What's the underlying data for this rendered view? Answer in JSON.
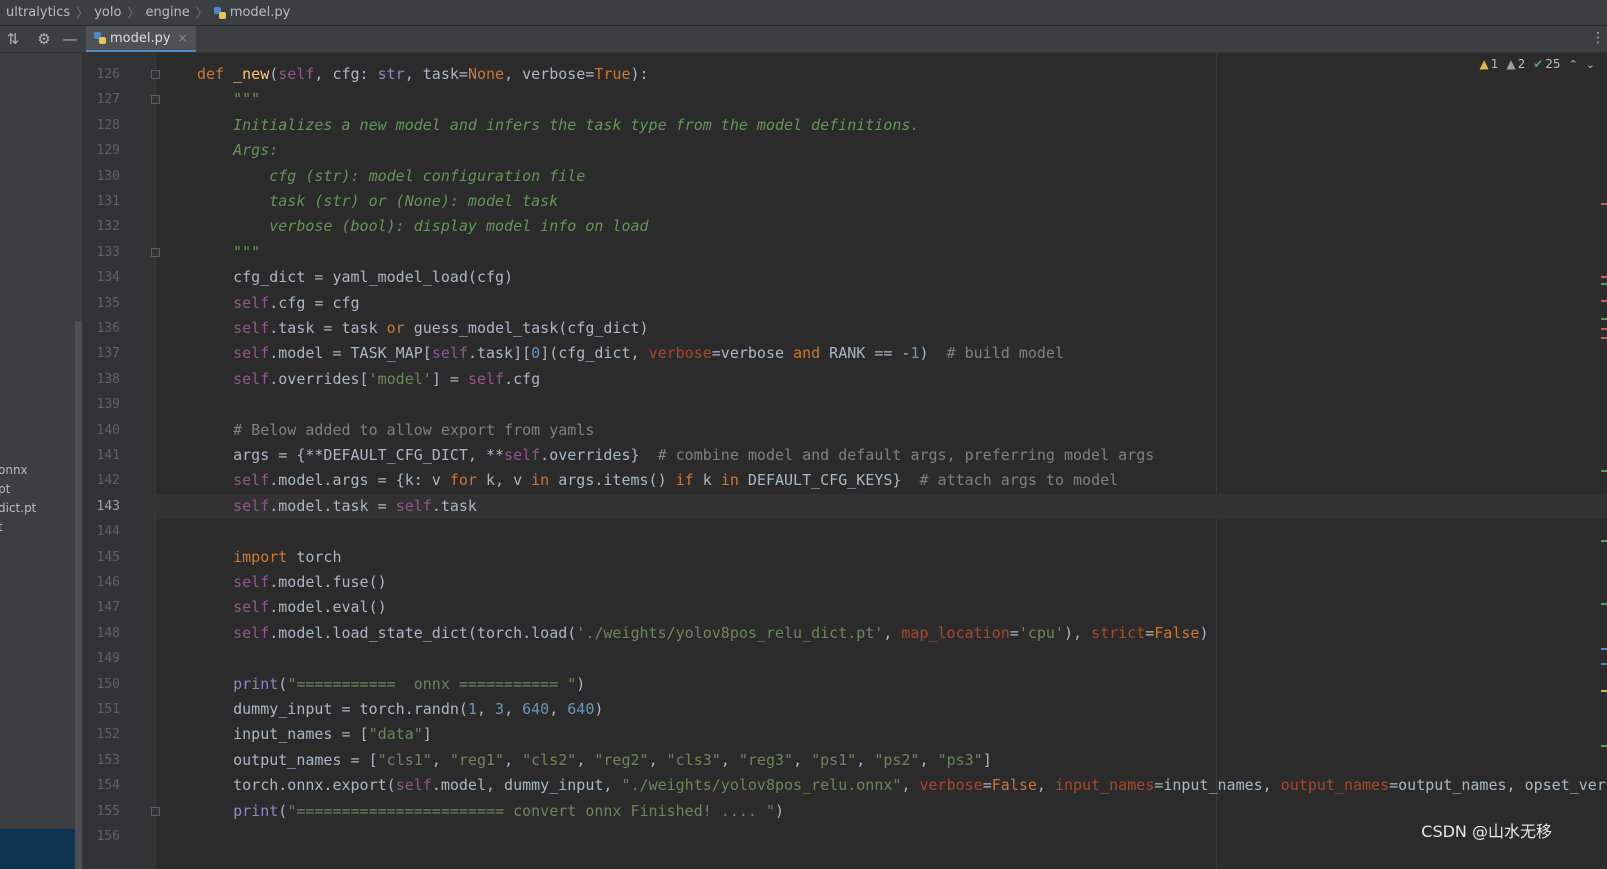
{
  "breadcrumb": [
    "ultralytics",
    "yolo",
    "engine",
    "model.py"
  ],
  "tab": {
    "label": "model.py",
    "close": "×"
  },
  "project_files": [
    "onnx",
    "pt",
    "dict.pt",
    "t"
  ],
  "inspections": {
    "warnings": "1",
    "weak_warnings": "2",
    "ok": "25"
  },
  "line_numbers": [
    "126",
    "127",
    "128",
    "129",
    "130",
    "131",
    "132",
    "133",
    "134",
    "135",
    "136",
    "137",
    "138",
    "139",
    "140",
    "141",
    "142",
    "143",
    "144",
    "145",
    "146",
    "147",
    "148",
    "149",
    "150",
    "151",
    "152",
    "153",
    "154",
    "155",
    "156"
  ],
  "current_line": "143",
  "watermark": "CSDN @山水无移",
  "colors": {
    "keyword": "#cc7832",
    "function": "#ffc66d",
    "self": "#94558d",
    "string": "#6a8759",
    "number": "#6897bb",
    "comment": "#808080",
    "docstring": "#629755",
    "param": "#aa4926",
    "editor_bg": "#2b2b2b"
  },
  "code": [
    "def _new(self, cfg: str, task=None, verbose=True):",
    "    \"\"\"",
    "    Initializes a new model and infers the task type from the model definitions.",
    "    Args:",
    "        cfg (str): model configuration file",
    "        task (str) or (None): model task",
    "        verbose (bool): display model info on load",
    "    \"\"\"",
    "    cfg_dict = yaml_model_load(cfg)",
    "    self.cfg = cfg",
    "    self.task = task or guess_model_task(cfg_dict)",
    "    self.model = TASK_MAP[self.task][0](cfg_dict, verbose=verbose and RANK == -1)  # build model",
    "    self.overrides['model'] = self.cfg",
    "",
    "    # Below added to allow export from yamls",
    "    args = {**DEFAULT_CFG_DICT, **self.overrides}  # combine model and default args, preferring model args",
    "    self.model.args = {k: v for k, v in args.items() if k in DEFAULT_CFG_KEYS}  # attach args to model",
    "    self.model.task = self.task",
    "",
    "    import torch",
    "    self.model.fuse()",
    "    self.model.eval()",
    "    self.model.load_state_dict(torch.load('./weights/yolov8pos_relu_dict.pt', map_location='cpu'), strict=False)",
    "",
    "    print(\"===========  onnx =========== \")",
    "    dummy_input = torch.randn(1, 3, 640, 640)",
    "    input_names = [\"data\"]",
    "    output_names = [\"cls1\", \"reg1\", \"cls2\", \"reg2\", \"cls3\", \"reg3\", \"ps1\", \"ps2\", \"ps3\"]",
    "    torch.onnx.export(self.model, dummy_input, \"./weights/yolov8pos_relu.onnx\", verbose=False, input_names=input_names, output_names=output_names, opset_ver",
    "    print(\"======================= convert onnx Finished! .... \")",
    ""
  ]
}
